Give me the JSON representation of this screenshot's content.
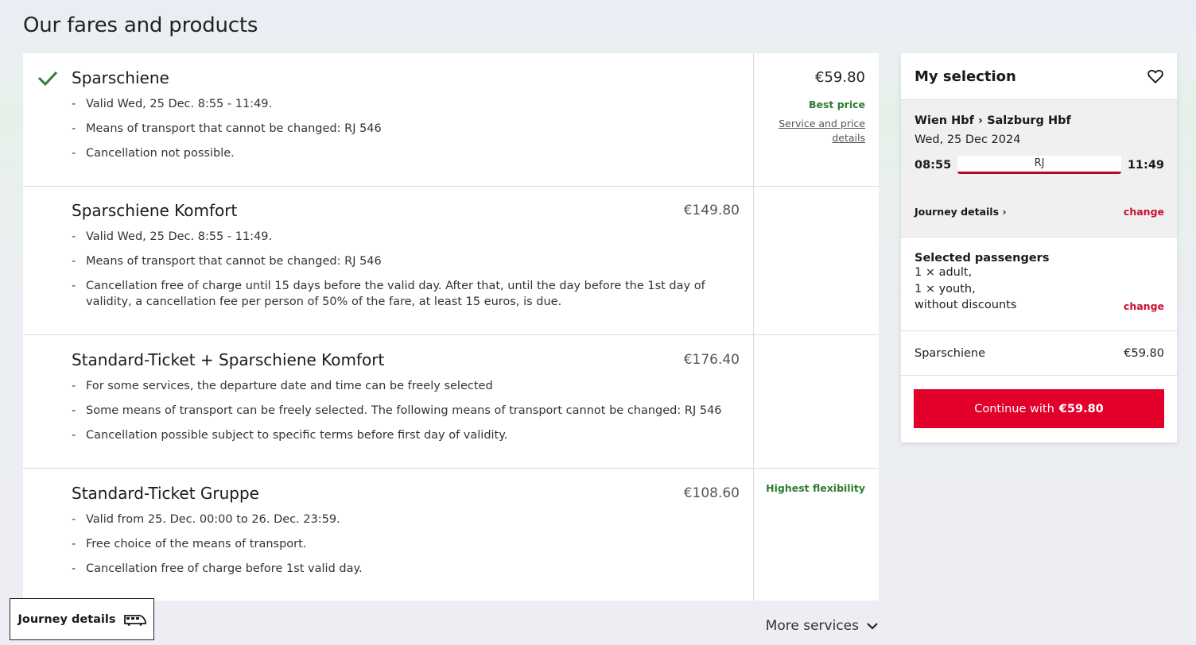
{
  "page": {
    "title": "Our fares and products"
  },
  "fares": [
    {
      "name": "Sparschiene",
      "selected": true,
      "price": "€59.80",
      "badge": "Best price",
      "link": "Service and price details",
      "details": [
        "Valid Wed, 25 Dec. 8:55 - 11:49.",
        "Means of transport that cannot be changed: RJ 546",
        "Cancellation not possible."
      ]
    },
    {
      "name": "Sparschiene Komfort",
      "price": "€149.80",
      "details": [
        "Valid Wed, 25 Dec. 8:55 - 11:49.",
        "Means of transport that cannot be changed: RJ 546",
        "Cancellation free of charge until 15 days before the valid day. After that, until the day before the 1st day of validity, a cancellation fee per person of 50% of the fare, at least 15 euros, is due."
      ]
    },
    {
      "name": "Standard-Ticket + Sparschiene Komfort",
      "price": "€176.40",
      "details": [
        "For some services, the departure date and time can be freely selected",
        "Some means of transport can be freely selected. The following means of transport cannot be changed: RJ 546",
        "Cancellation possible subject to specific terms before first day of validity."
      ]
    },
    {
      "name": "Standard-Ticket Gruppe",
      "price": "€108.60",
      "badge": "Highest flexibility",
      "details": [
        "Valid from 25. Dec. 00:00 to 26. Dec. 23:59.",
        "Free choice of the means of transport.",
        "Cancellation free of charge before 1st valid day."
      ]
    }
  ],
  "selection": {
    "title": "My selection",
    "route": "Wien Hbf › Salzburg Hbf",
    "date": "Wed, 25 Dec 2024",
    "dep_time": "08:55",
    "arr_time": "11:49",
    "train": "RJ",
    "journey_details": "Journey details ›",
    "change": "change",
    "pax_title": "Selected passengers",
    "pax_lines": [
      "1 × adult,",
      "1 × youth,",
      "without discounts"
    ],
    "summary_name": "Sparschiene",
    "summary_price": "€59.80",
    "cta_prefix": "Continue with",
    "cta_price": "€59.80"
  },
  "bottom": {
    "journey_details_button": "Journey details",
    "more_services": "More services"
  },
  "colors": {
    "brand_red": "#e2002a",
    "green": "#2e7d32",
    "change_red": "#c8102e"
  },
  "icons": [
    "check-icon",
    "heart-icon",
    "train-icon",
    "chevron-down-icon"
  ]
}
